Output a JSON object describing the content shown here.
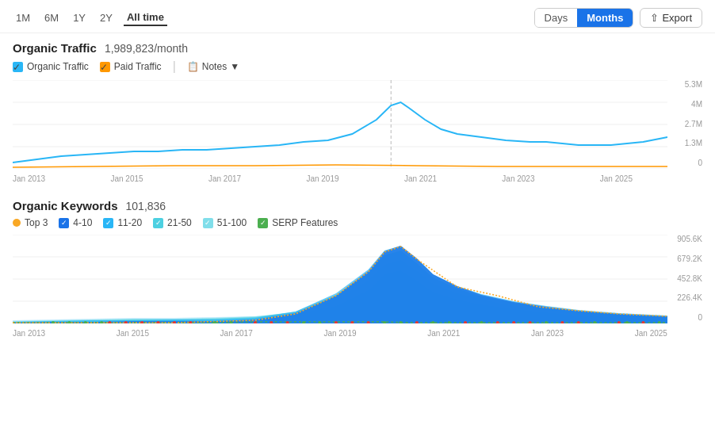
{
  "topBar": {
    "timeFilters": [
      "1M",
      "6M",
      "1Y",
      "2Y",
      "All time"
    ],
    "activeFilter": "All time",
    "viewOptions": [
      "Days",
      "Months"
    ],
    "activeView": "Months",
    "exportLabel": "Export"
  },
  "trafficSection": {
    "title": "Organic Traffic",
    "value": "1,989,823/month",
    "legend": [
      {
        "label": "Organic Traffic",
        "color": "#29b6f6",
        "type": "checkbox"
      },
      {
        "label": "Paid Traffic",
        "color": "#ff9800",
        "type": "checkbox"
      },
      {
        "label": "Notes",
        "type": "notes"
      }
    ],
    "yAxisLabels": [
      "5.3M",
      "4M",
      "2.7M",
      "1.3M",
      "0"
    ],
    "xAxisLabels": [
      "Jan 2013",
      "Jan 2015",
      "Jan 2017",
      "Jan 2019",
      "Jan 2021",
      "Jan 2023",
      "Jan 2025"
    ]
  },
  "keywordsSection": {
    "title": "Organic Keywords",
    "value": "101,836",
    "legend": [
      {
        "label": "Top 3",
        "color": "#f9a825",
        "type": "dot"
      },
      {
        "label": "4-10",
        "color": "#1a73e8",
        "type": "checkbox"
      },
      {
        "label": "11-20",
        "color": "#29b6f6",
        "type": "checkbox"
      },
      {
        "label": "21-50",
        "color": "#4dd0e1",
        "type": "checkbox"
      },
      {
        "label": "51-100",
        "color": "#80deea",
        "type": "checkbox"
      },
      {
        "label": "SERP Features",
        "color": "#4caf50",
        "type": "checkbox"
      }
    ],
    "yAxisLabels": [
      "905.6K",
      "679.2K",
      "452.8K",
      "226.4K",
      "0"
    ],
    "xAxisLabels": [
      "Jan 2013",
      "Jan 2015",
      "Jan 2017",
      "Jan 2019",
      "Jan 2021",
      "Jan 2023",
      "Jan 2025"
    ]
  }
}
